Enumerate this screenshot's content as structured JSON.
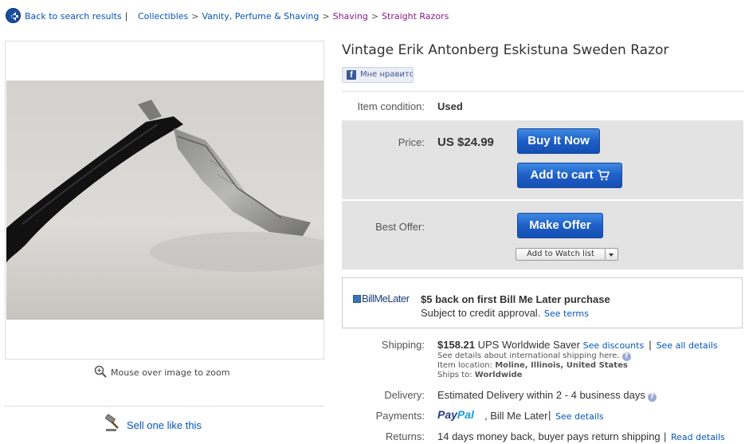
{
  "breadcrumb": {
    "back_label": "Back to search results",
    "separator": "|",
    "categories": [
      "Collectibles",
      "Vanity, Perfume & Shaving",
      "Shaving",
      "Straight Razors"
    ],
    "category_sep": ">"
  },
  "gallery": {
    "zoom_hint": "Mouse over image to zoom",
    "sell_label": "Sell one like this"
  },
  "listing": {
    "title": "Vintage Erik Antonberg Eskistuna Sweden Razor",
    "like_button": "Мне нравитс",
    "like_logo": "f"
  },
  "condition": {
    "label": "Item condition:",
    "value": "Used"
  },
  "price": {
    "label": "Price:",
    "value": "US $24.99",
    "buy_now": "Buy It Now",
    "add_to_cart": "Add to cart"
  },
  "best_offer": {
    "label": "Best Offer:",
    "make_offer": "Make Offer",
    "watch": "Add to Watch list"
  },
  "bill_me_later": {
    "logo": "BillMeLater",
    "headline": "$5 back on first Bill Me Later purchase",
    "subtext": "Subject to credit approval.",
    "terms": "See terms"
  },
  "shipping": {
    "label": "Shipping:",
    "amount": "$158.21",
    "service": "UPS Worldwide Saver",
    "see_discounts": "See discounts",
    "pipe": "|",
    "see_all": "See all details",
    "intl_note": "See details about international shipping here.",
    "location_label": "Item location:",
    "location_value": "Moline, Illinois, United States",
    "ships_to_label": "Ships to:",
    "ships_to_value": "Worldwide"
  },
  "delivery": {
    "label": "Delivery:",
    "value": "Estimated Delivery within 2 - 4 business days"
  },
  "payments": {
    "label": "Payments:",
    "paypal_a": "Pay",
    "paypal_b": "Pal",
    "bill_me_later": ", Bill Me Later",
    "pipe": "|",
    "details": "See details"
  },
  "returns": {
    "label": "Returns:",
    "value": "14 days money back, buyer pays return shipping",
    "pipe": "|",
    "details": "Read details"
  },
  "colors": {
    "link": "#0654ba",
    "visited": "#8b1a8b",
    "button": "#1f5fc7",
    "panel": "#e3e3e3"
  }
}
